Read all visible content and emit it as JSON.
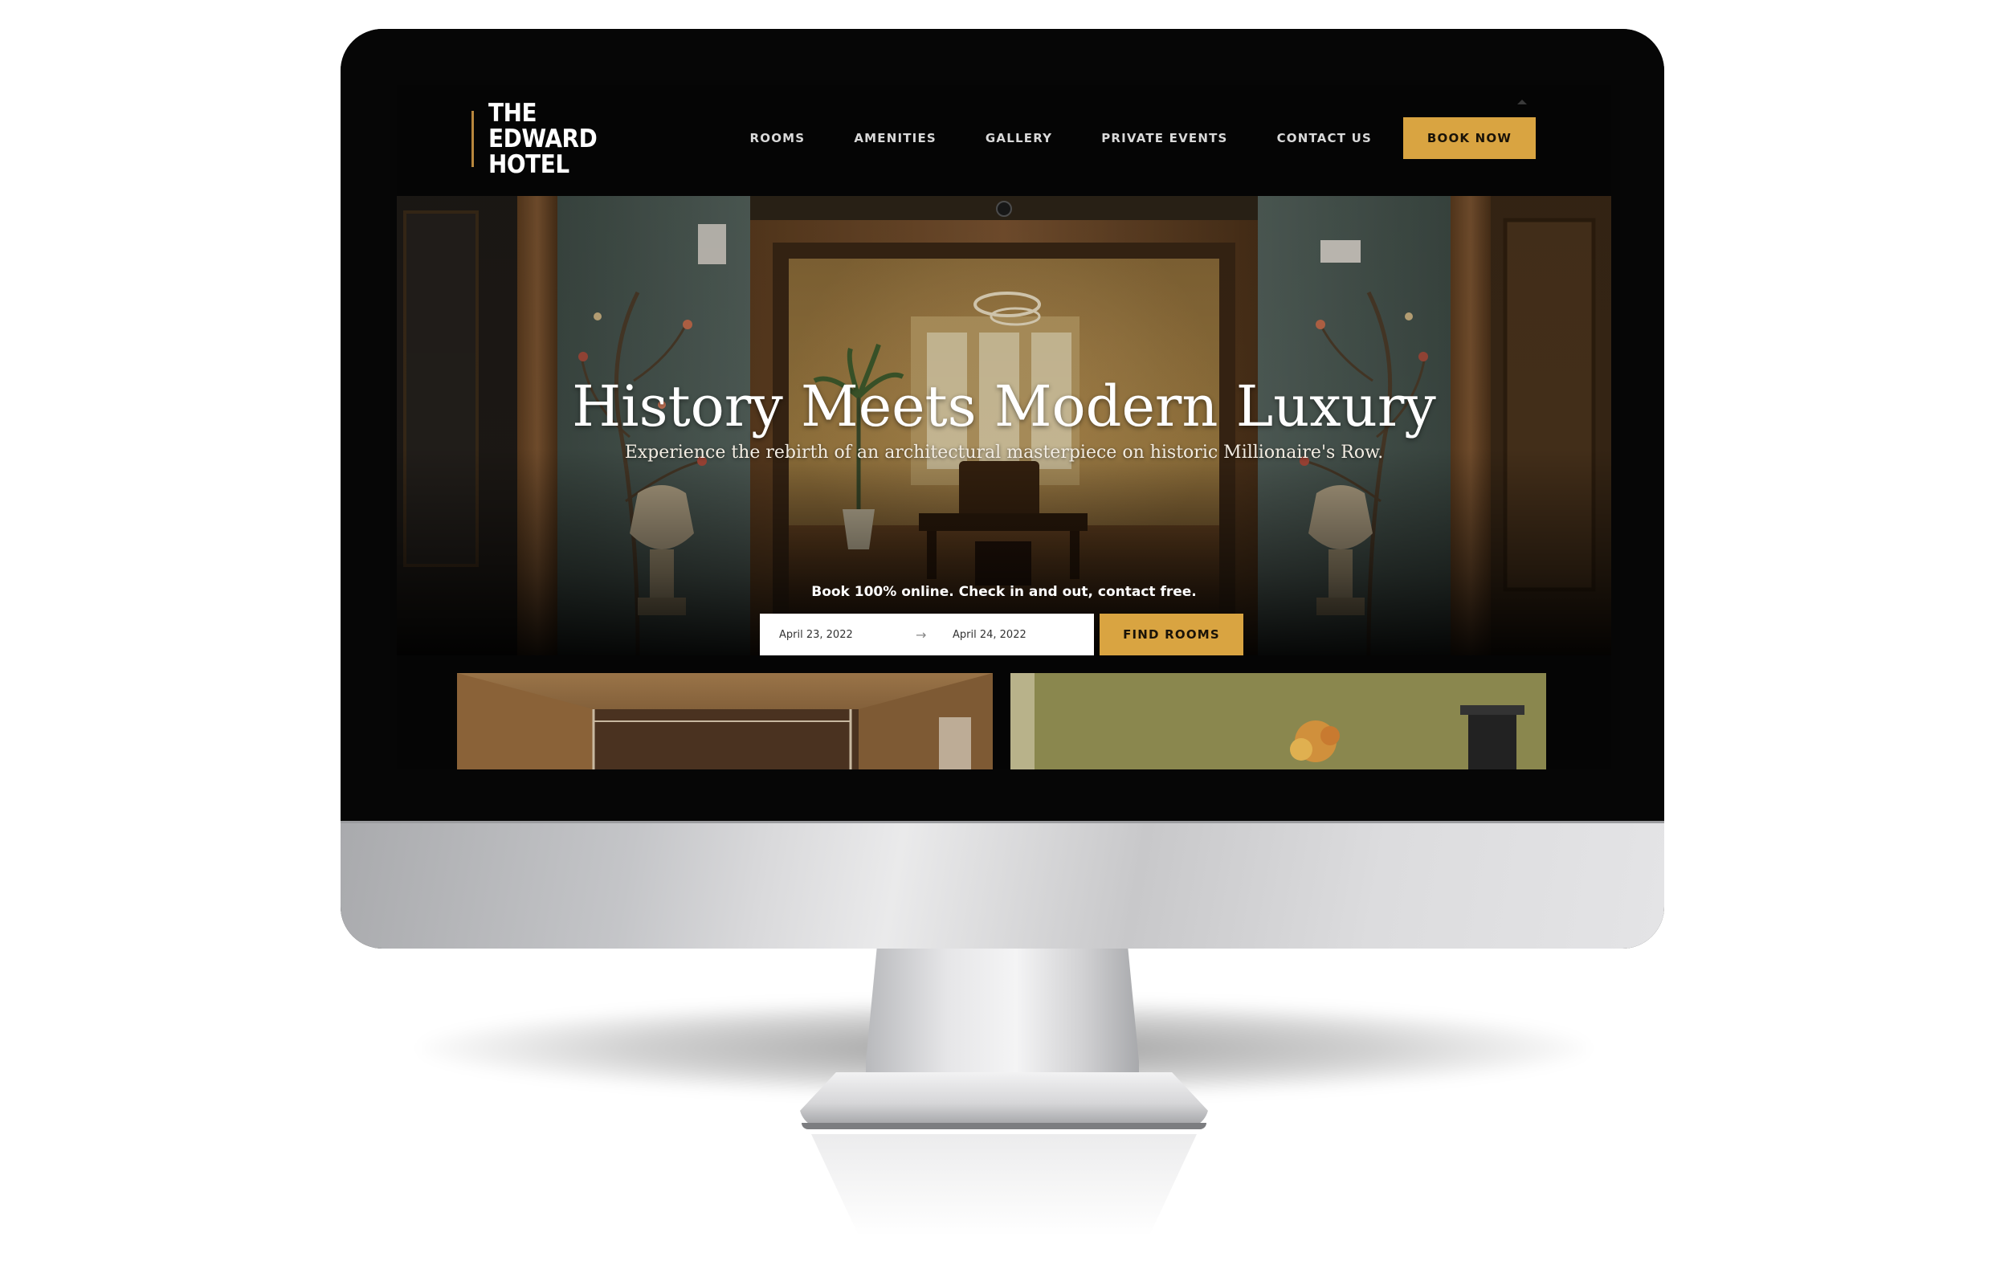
{
  "site": {
    "logo_lines": [
      "THE",
      "EDWARD",
      "HOTEL"
    ],
    "nav": {
      "items": [
        "ROOMS",
        "AMENITIES",
        "GALLERY",
        "PRIVATE EVENTS",
        "CONTACT US"
      ],
      "book_label": "BOOK NOW"
    }
  },
  "hero": {
    "title": "History Meets Modern Luxury",
    "subtitle": "Experience the rebirth of an architectural masterpiece on historic Millionaire's Row.",
    "note": "Book 100% online. Check in and out, contact free.",
    "checkin": "April 23, 2022",
    "checkout": "April 24, 2022",
    "arrow_icon": "arrow-right-icon",
    "find_label": "FIND ROOMS"
  },
  "colors": {
    "accent": "#d9a441",
    "header_bg": "#050505",
    "logo_bar": "#b8873d"
  }
}
